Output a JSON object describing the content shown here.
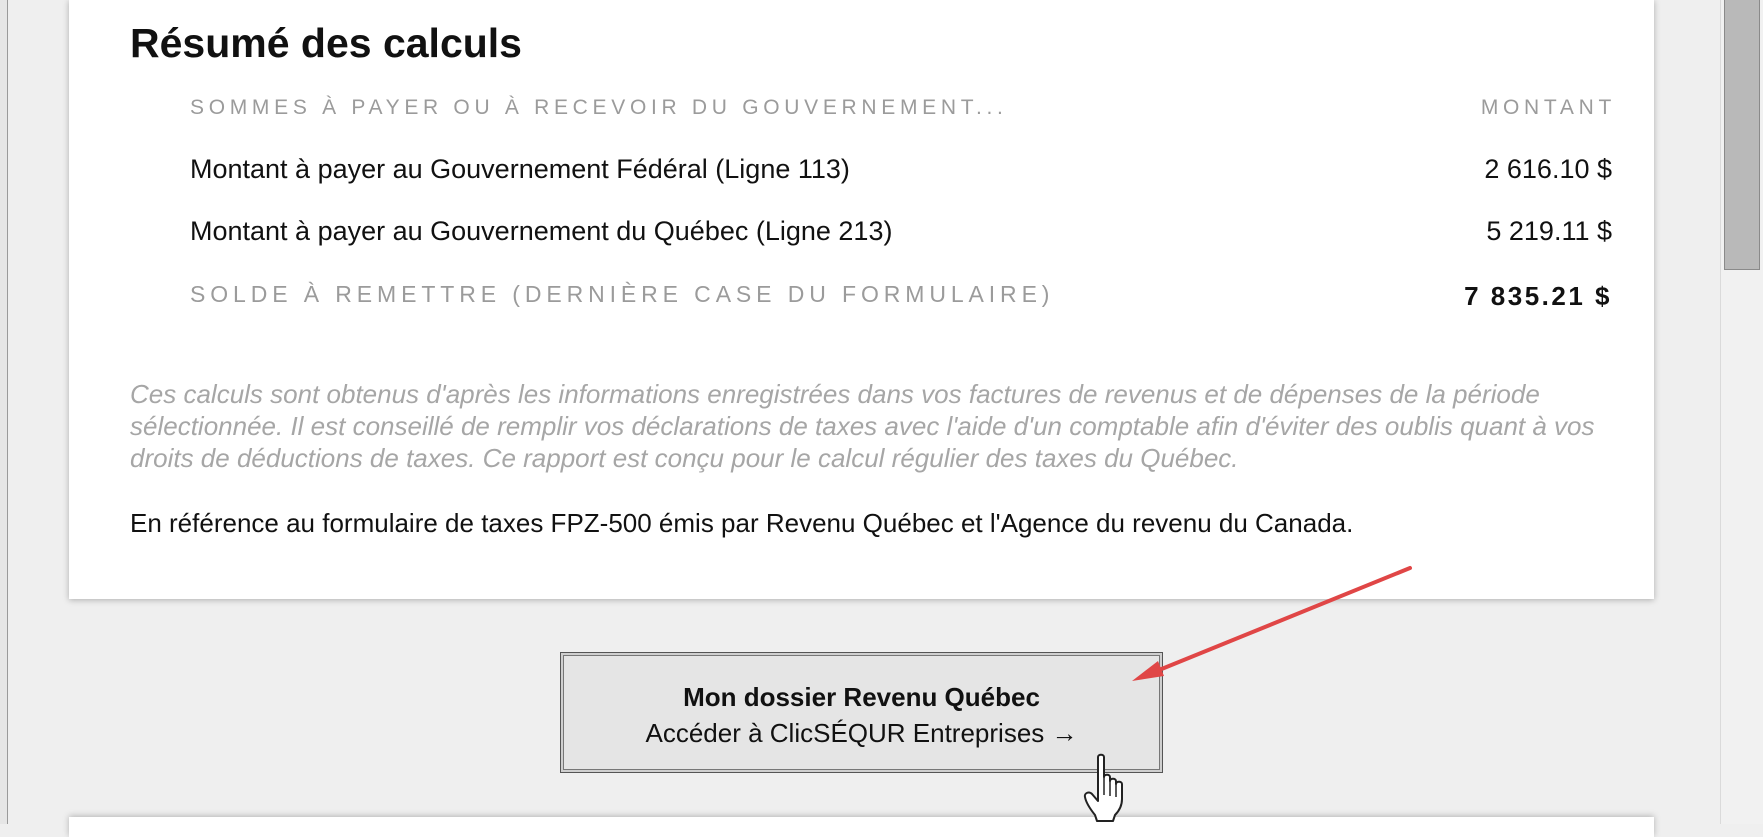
{
  "summary": {
    "title": "Résumé des calculs",
    "header": {
      "label": "SOMMES À PAYER OU À RECEVOIR DU GOUVERNEMENT...",
      "amount": "MONTANT"
    },
    "rows": [
      {
        "label": "Montant à payer au Gouvernement Fédéral (Ligne 113)",
        "amount": "2 616.10 $"
      },
      {
        "label": "Montant à payer au Gouvernement du Québec (Ligne 213)",
        "amount": "5 219.11 $"
      }
    ],
    "balance": {
      "label": "SOLDE À REMETTRE (DERNIÈRE CASE DU FORMULAIRE)",
      "amount": "7 835.21 $"
    },
    "note": "Ces calculs sont obtenus d'après les informations enregistrées dans vos factures de revenus et de dépenses de la période sélectionnée. Il est conseillé de remplir vos déclarations de taxes avec l'aide d'un comptable afin d'éviter des oublis quant à vos droits de déductions de taxes. Ce rapport est conçu pour le calcul régulier des taxes du Québec.",
    "reference": "En référence au formulaire de taxes FPZ-500 émis par Revenu Québec et l'Agence du revenu du Canada."
  },
  "cta": {
    "title": "Mon dossier Revenu Québec",
    "subtitle": "Accéder à ClicSÉQUR Entreprises →"
  },
  "annotation": {
    "arrow_color": "#e04646",
    "icon": "hand-pointer-icon"
  }
}
